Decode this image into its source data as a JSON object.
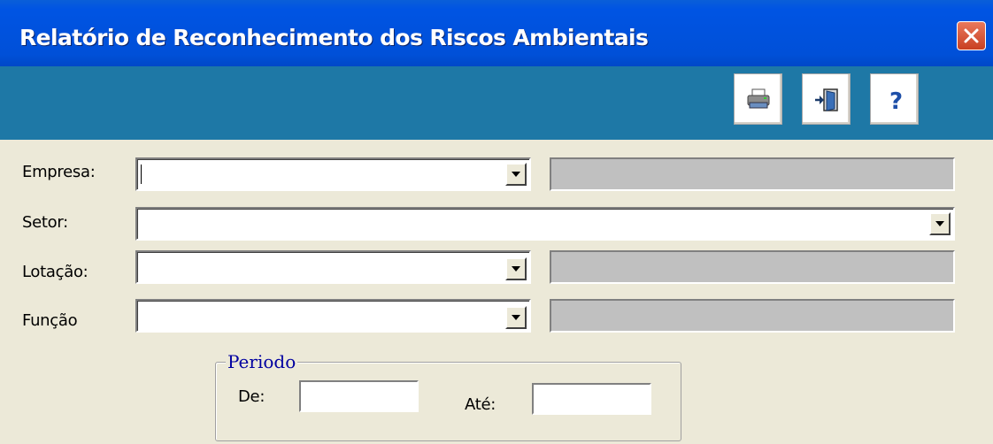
{
  "window": {
    "title": "Relatório de Reconhecimento dos Riscos Ambientais"
  },
  "toolbar": {
    "buttons": [
      {
        "name": "print",
        "icon": "printer-icon"
      },
      {
        "name": "exit",
        "icon": "exit-door-icon"
      },
      {
        "name": "help",
        "icon": "help-icon",
        "glyph": "?"
      }
    ]
  },
  "form": {
    "empresa": {
      "label": "Empresa:",
      "value": "",
      "description": ""
    },
    "setor": {
      "label": "Setor:",
      "value": ""
    },
    "lotacao": {
      "label": "Lotação:",
      "value": "",
      "description": ""
    },
    "funcao": {
      "label": "Função",
      "value": "",
      "description": ""
    }
  },
  "periodo": {
    "title": "Periodo",
    "de_label": "De:",
    "de_value": "",
    "ate_label": "Até:",
    "ate_value": ""
  },
  "colors": {
    "titlebar": "#0054E3",
    "toolbar": "#1E78A6",
    "window_bg": "#ECE9D8",
    "group_title": "#0000A0"
  }
}
